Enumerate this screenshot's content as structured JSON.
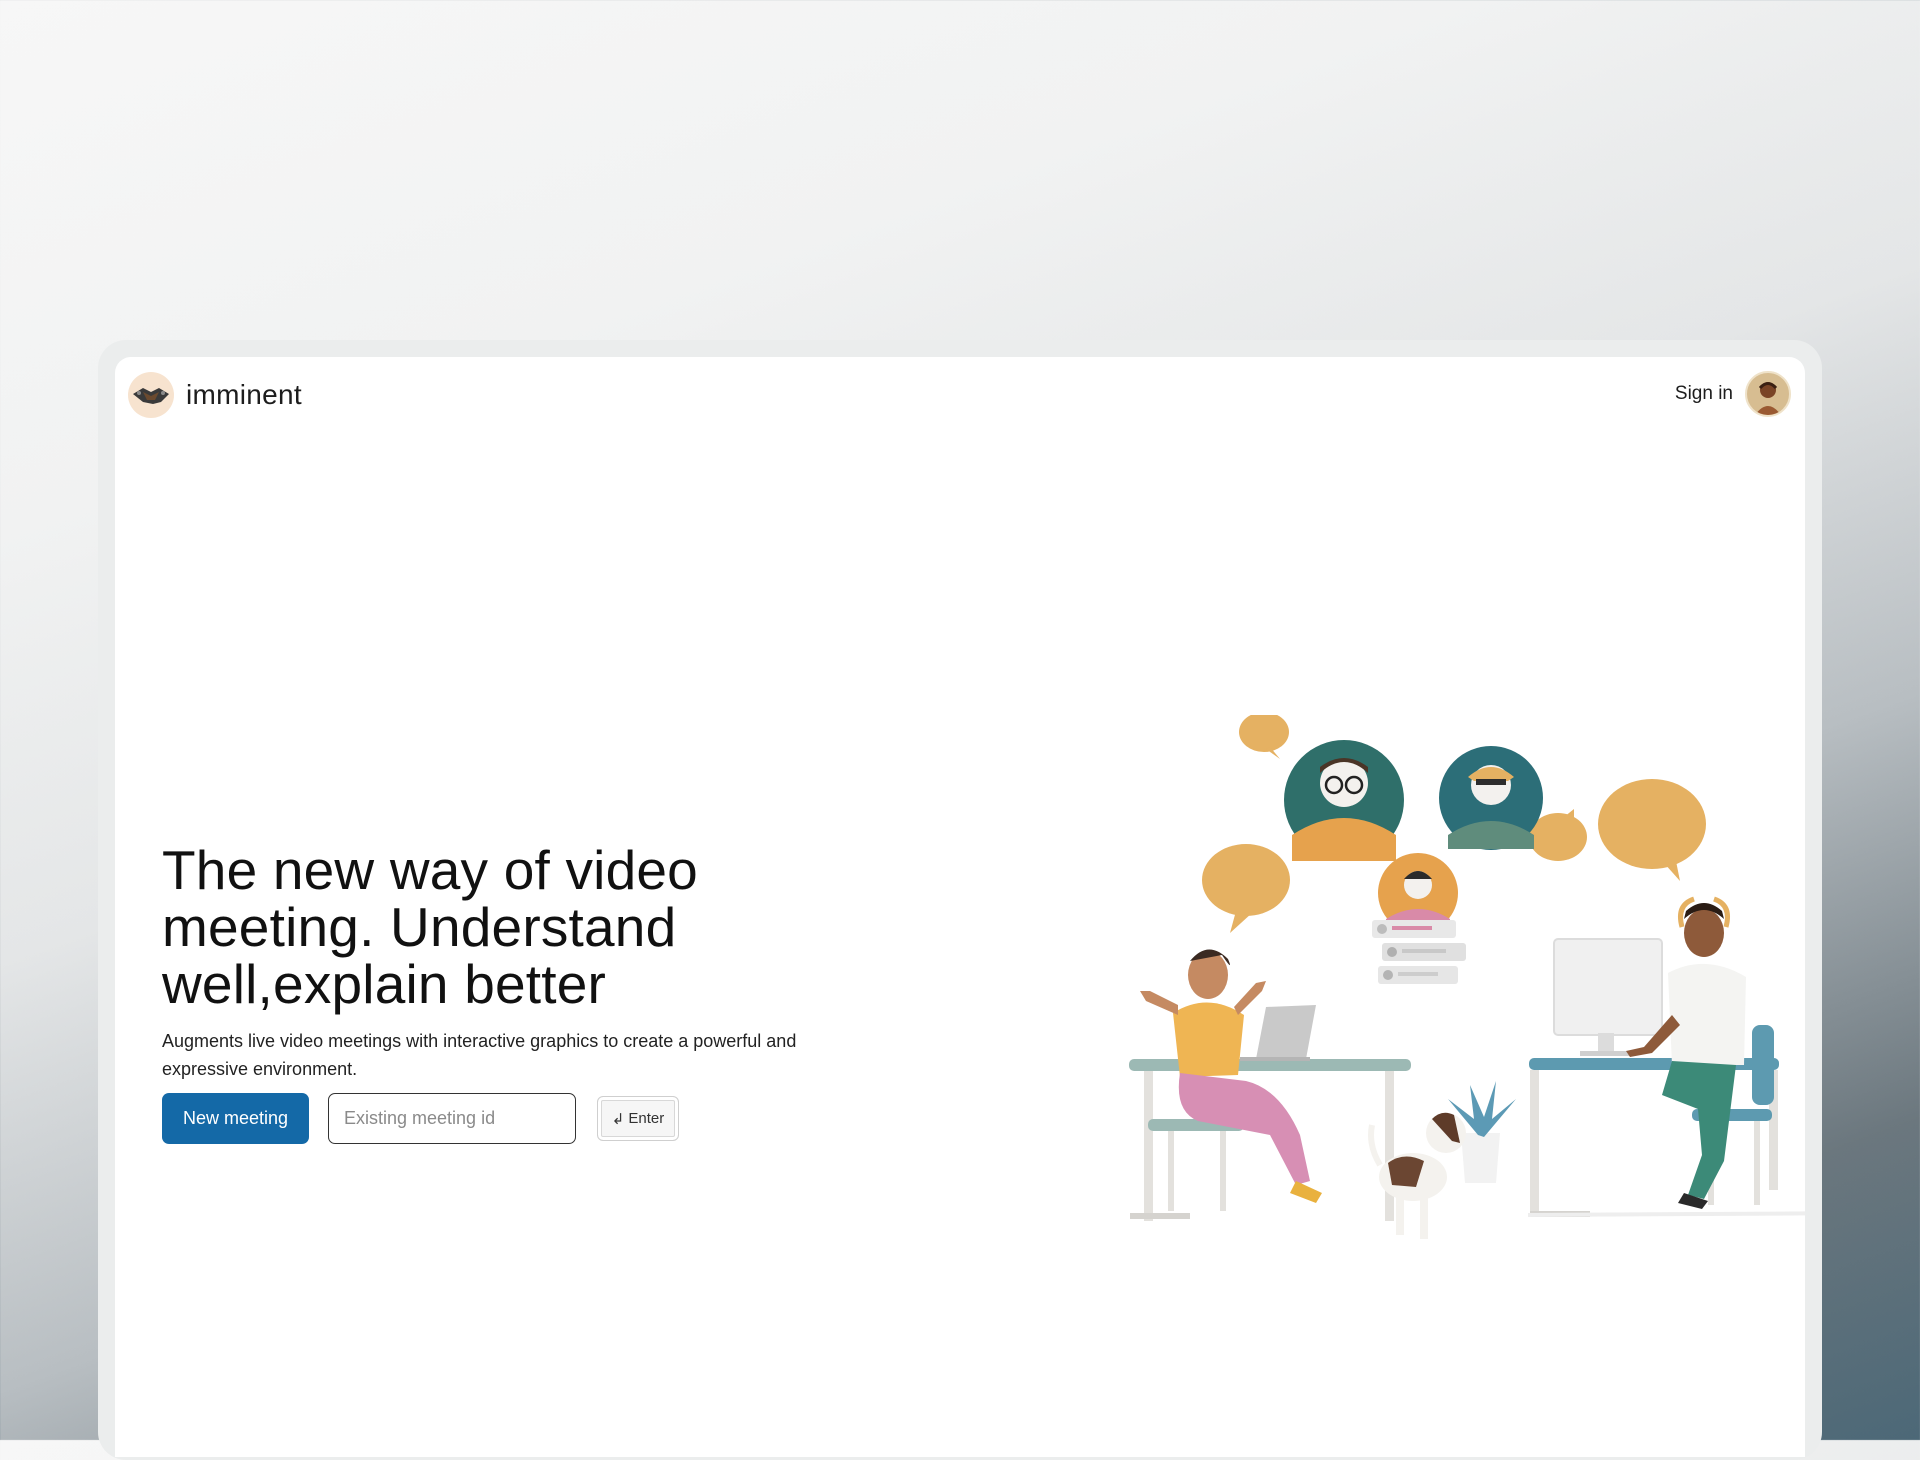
{
  "brand": {
    "name": "imminent",
    "logo_icon": "handshake-icon"
  },
  "nav": {
    "sign_in": "Sign in",
    "avatar_icon": "user-avatar"
  },
  "hero": {
    "title": "The new way of video meeting. Understand well,explain better",
    "subtitle": "Augments live video meetings with interactive graphics to create a powerful and expressive environment."
  },
  "actions": {
    "new_meeting": "New meeting",
    "meeting_id_placeholder": "Existing meeting id",
    "enter_label": "Enter",
    "enter_icon": "return-arrow-icon"
  },
  "colors": {
    "primary": "#1469a7",
    "bubble": "#e5b162",
    "teal": "#2f6f6a"
  }
}
